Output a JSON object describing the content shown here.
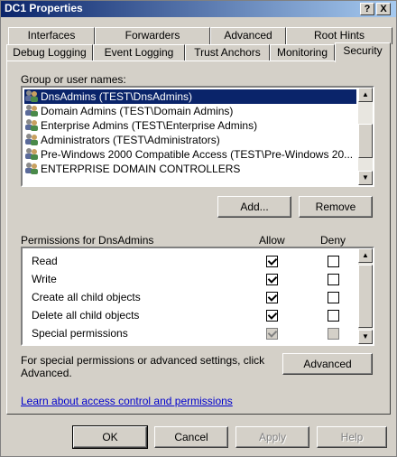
{
  "window": {
    "title": "DC1 Properties",
    "help_btn": "?",
    "close_btn": "X"
  },
  "tabs_back": [
    "Interfaces",
    "Forwarders",
    "Advanced",
    "Root Hints"
  ],
  "tabs_front": [
    "Debug Logging",
    "Event Logging",
    "Trust Anchors",
    "Monitoring",
    "Security"
  ],
  "group_label": "Group or user names:",
  "users": [
    {
      "name": "DnsAdmins (TEST\\DnsAdmins)",
      "selected": true
    },
    {
      "name": "Domain Admins (TEST\\Domain Admins)",
      "selected": false
    },
    {
      "name": "Enterprise Admins (TEST\\Enterprise Admins)",
      "selected": false
    },
    {
      "name": "Administrators (TEST\\Administrators)",
      "selected": false
    },
    {
      "name": "Pre-Windows 2000 Compatible Access (TEST\\Pre-Windows 20...",
      "selected": false
    },
    {
      "name": "ENTERPRISE DOMAIN CONTROLLERS",
      "selected": false
    }
  ],
  "buttons": {
    "add": "Add...",
    "remove": "Remove",
    "advanced": "Advanced",
    "ok": "OK",
    "cancel": "Cancel",
    "apply": "Apply",
    "help": "Help"
  },
  "permissions_header": {
    "title": "Permissions for DnsAdmins",
    "allow": "Allow",
    "deny": "Deny"
  },
  "permissions": [
    {
      "name": "Read",
      "allow": true,
      "deny": false,
      "inherited": false
    },
    {
      "name": "Write",
      "allow": true,
      "deny": false,
      "inherited": false
    },
    {
      "name": "Create all child objects",
      "allow": true,
      "deny": false,
      "inherited": false
    },
    {
      "name": "Delete all child objects",
      "allow": true,
      "deny": false,
      "inherited": false
    },
    {
      "name": "Special permissions",
      "allow": true,
      "deny": false,
      "inherited": true
    }
  ],
  "special_text_line1": "For special permissions or advanced settings, click",
  "special_text_line2": "Advanced.",
  "learn_link": "Learn about access control and permissions"
}
